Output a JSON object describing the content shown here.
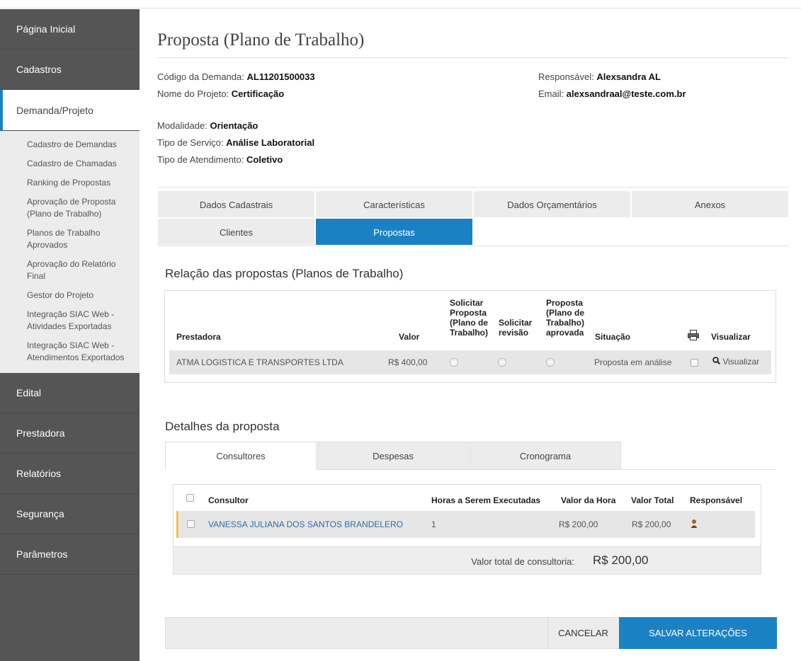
{
  "sidebar": {
    "items": [
      {
        "label": "Página Inicial"
      },
      {
        "label": "Cadastros"
      },
      {
        "label": "Demanda/Projeto"
      },
      {
        "label": "Edital"
      },
      {
        "label": "Prestadora"
      },
      {
        "label": "Relatórios"
      },
      {
        "label": "Segurança"
      },
      {
        "label": "Parâmetros"
      }
    ],
    "submenu": [
      "Cadastro de Demandas",
      "Cadastro de Chamadas",
      "Ranking de Propostas",
      "Aprovação de Proposta (Plano de Trabalho)",
      "Planos de Trabalho Aprovados",
      "Aprovação do Relatório Final",
      "Gestor do Projeto",
      "Integração SIAC Web - Atividades Exportadas",
      "Integração SIAC Web - Atendimentos Exportados"
    ]
  },
  "page": {
    "title": "Proposta (Plano de Trabalho)"
  },
  "info": {
    "codigo_label": "Código da Demanda:",
    "codigo_value": "AL11201500033",
    "nome_label": "Nome do Projeto:",
    "nome_value": "Certificação",
    "responsavel_label": "Responsável:",
    "responsavel_value": "Alexsandra AL",
    "email_label": "Email:",
    "email_value": "alexsandraal@teste.com.br",
    "modalidade_label": "Modalidade:",
    "modalidade_value": "Orientação",
    "servico_label": "Tipo de Serviço:",
    "servico_value": "Análise Laboratorial",
    "atendimento_label": "Tipo de Atendimento:",
    "atendimento_value": "Coletivo"
  },
  "tabs": {
    "row1": [
      "Dados Cadastrais",
      "Características",
      "Dados Orçamentários",
      "Anexos"
    ],
    "row2": [
      "Clientes",
      "Propostas"
    ],
    "selected": "Propostas"
  },
  "propostas": {
    "title": "Relação das propostas (Planos de Trabalho)",
    "headers": {
      "prestadora": "Prestadora",
      "valor": "Valor",
      "solicitar_proposta": [
        "Solicitar",
        "Proposta",
        "(Plano de",
        "Trabalho)"
      ],
      "solicitar_revisao": [
        "Solicitar",
        "revisão"
      ],
      "proposta_aprovada": [
        "Proposta",
        "(Plano de",
        "Trabalho)",
        "aprovada"
      ],
      "situacao": "Situação",
      "visualizar": "Visualizar"
    },
    "rows": [
      {
        "prestadora": "ATMA LOGISTICA E TRANSPORTES LTDA",
        "valor": "R$ 400,00",
        "situacao": "Proposta em análise",
        "visualizar": "Visualizar"
      }
    ]
  },
  "detalhes": {
    "title": "Detalhes da proposta",
    "tabs": [
      "Consultores",
      "Despesas",
      "Cronograma"
    ],
    "selected_tab": "Consultores",
    "headers": {
      "consultor": "Consultor",
      "horas": "Horas a Serem Executadas",
      "valor_hora": "Valor da Hora",
      "valor_total": "Valor Total",
      "responsavel": "Responsável"
    },
    "rows": [
      {
        "consultor": "VANESSA JULIANA DOS SANTOS BRANDELERO",
        "horas": "1",
        "valor_hora": "R$ 200,00",
        "valor_total": "R$ 200,00"
      }
    ],
    "total_label": "Valor total de consultoria:",
    "total_value": "R$ 200,00"
  },
  "footer": {
    "cancel_label": "CANCELAR",
    "save_label": "SALVAR ALTERAÇÕES"
  },
  "colors": {
    "accent": "#1a82c4",
    "sidebar": "#555555"
  }
}
